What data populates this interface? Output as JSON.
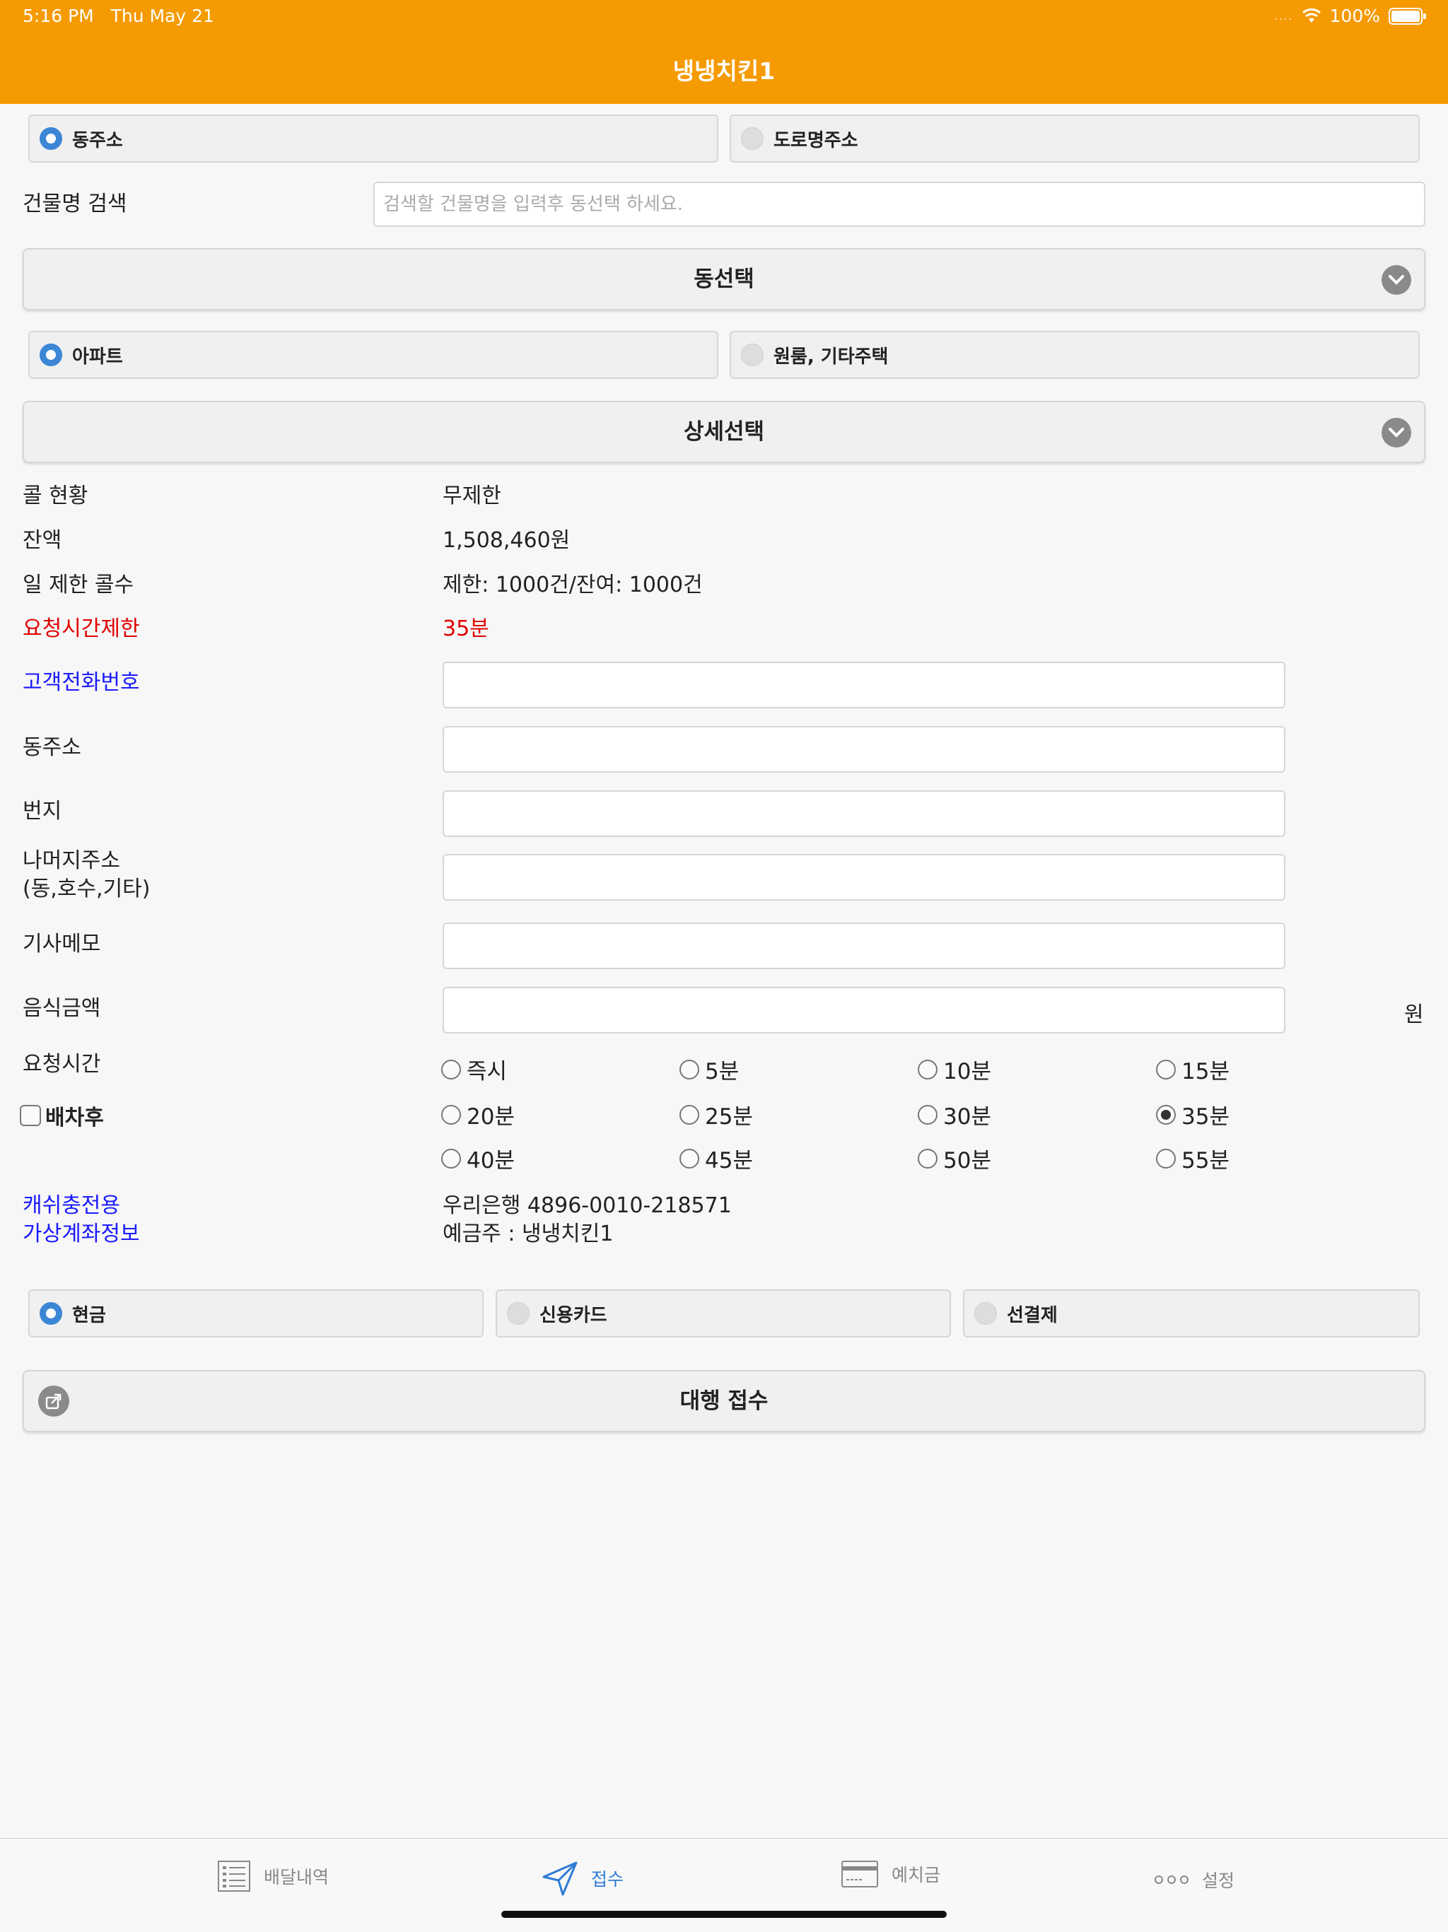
{
  "status_bar": {
    "time": "5:16 PM",
    "date": "Thu May 21",
    "battery": "100%"
  },
  "header": {
    "title": "냉냉치킨1"
  },
  "address_type": {
    "options": [
      "동주소",
      "도로명주소"
    ],
    "selected": "동주소"
  },
  "building_search": {
    "label": "건물명 검색",
    "placeholder": "검색할 건물명을 입력후 동선택 하세요."
  },
  "dong_select": {
    "label": "동선택"
  },
  "housing_type": {
    "options": [
      "아파트",
      "원룸, 기타주택"
    ],
    "selected": "아파트"
  },
  "detail_select": {
    "label": "상세선택"
  },
  "info": [
    {
      "label": "콜 현황",
      "value": "무제한"
    },
    {
      "label": "잔액",
      "value": "1,508,460원"
    },
    {
      "label": "일 제한 콜수",
      "value": "제한: 1000건/잔여: 1000건"
    },
    {
      "label": "요청시간제한",
      "value": "35분"
    }
  ],
  "form": {
    "phone_label": "고객전화번호",
    "dong_label": "동주소",
    "bunji_label": "번지",
    "rest_label_1": "나머지주소",
    "rest_label_2": "(동,호수,기타)",
    "memo_label": "기사메모",
    "amount_label": "음식금액",
    "amount_unit": "원"
  },
  "request_time": {
    "label": "요청시간",
    "checkbox_label": "배차후",
    "checkbox_checked": false,
    "options": [
      "즉시",
      "5분",
      "10분",
      "15분",
      "20분",
      "25분",
      "30분",
      "35분",
      "40분",
      "45분",
      "50분",
      "55분"
    ],
    "selected": "35분"
  },
  "virtual_account": {
    "label_1": "캐쉬충전용",
    "label_2": "가상계좌정보",
    "account": "우리은행 4896-0010-218571",
    "holder": "예금주 : 냉냉치킨1"
  },
  "payment": {
    "options": [
      "현금",
      "신용카드",
      "선결제"
    ],
    "selected": "현금"
  },
  "submit": {
    "label": "대행 접수"
  },
  "tabs": [
    {
      "label": "배달내역",
      "icon": "list-icon"
    },
    {
      "label": "접수",
      "icon": "send-icon",
      "active": true
    },
    {
      "label": "예치금",
      "icon": "card-icon"
    },
    {
      "label": "설정",
      "icon": "more-icon"
    }
  ],
  "colors": {
    "header": "#f59a00",
    "accent": "#3c86d6",
    "red": "#e00000",
    "blue": "#1a1aff"
  }
}
